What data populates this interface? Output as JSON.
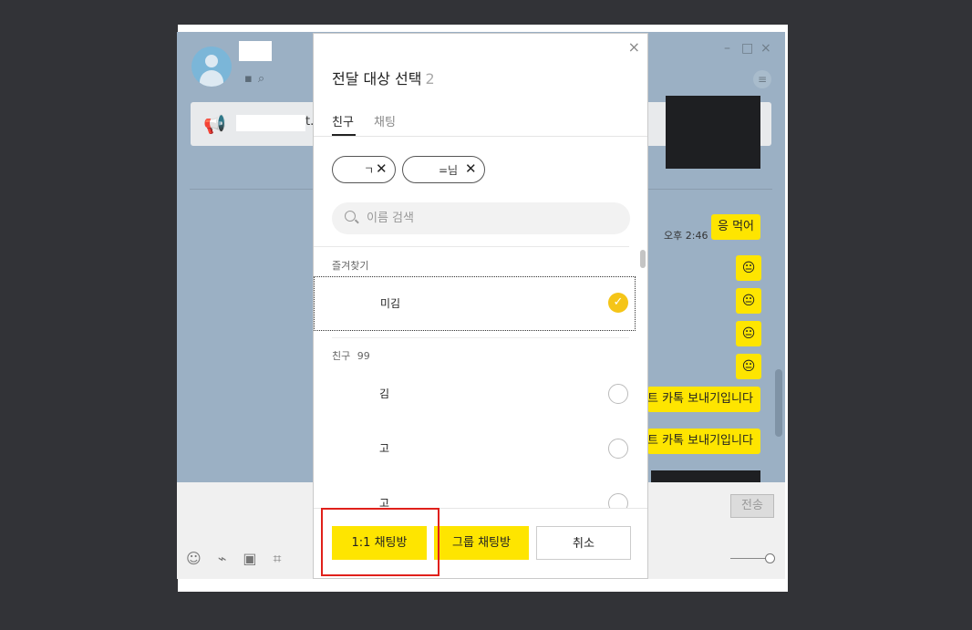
{
  "chat": {
    "notice_text_fragment": "t.",
    "messages": [
      {
        "time": "오후 2:46",
        "text": "응 먹어"
      },
      {
        "emoticon": "😐"
      },
      {
        "emoticon": "😐"
      },
      {
        "emoticon": "😐"
      },
      {
        "emoticon": "😐"
      },
      {
        "text": "트 카톡 보내기입니다"
      },
      {
        "text": "트 카톡 보내기입니다"
      }
    ],
    "send_label": "전송"
  },
  "modal": {
    "title": "전달 대상 선택",
    "selected_count": "2",
    "close_icon": "×",
    "tabs": [
      {
        "label": "친구",
        "active": true
      },
      {
        "label": "채팅",
        "active": false
      }
    ],
    "chips": [
      {
        "label": "ㄱ"
      },
      {
        "label": "=님"
      }
    ],
    "search_placeholder": "이름 검색",
    "favorites_label": "즐겨찾기",
    "favorites": [
      {
        "name": "미김",
        "checked": true
      }
    ],
    "friends_label": "친구",
    "friends_count": "99",
    "friends": [
      {
        "name": "김",
        "checked": false
      },
      {
        "name": "고",
        "checked": false
      },
      {
        "name": "고",
        "checked": false
      }
    ],
    "buttons": {
      "one_to_one": "1:1 채팅방",
      "group": "그룹 채팅방",
      "cancel": "취소"
    }
  },
  "colors": {
    "accent_yellow": "#fee500",
    "check_yellow": "#f5c518",
    "highlight_red": "#e0201b",
    "chat_bg": "#9bb0c4"
  }
}
